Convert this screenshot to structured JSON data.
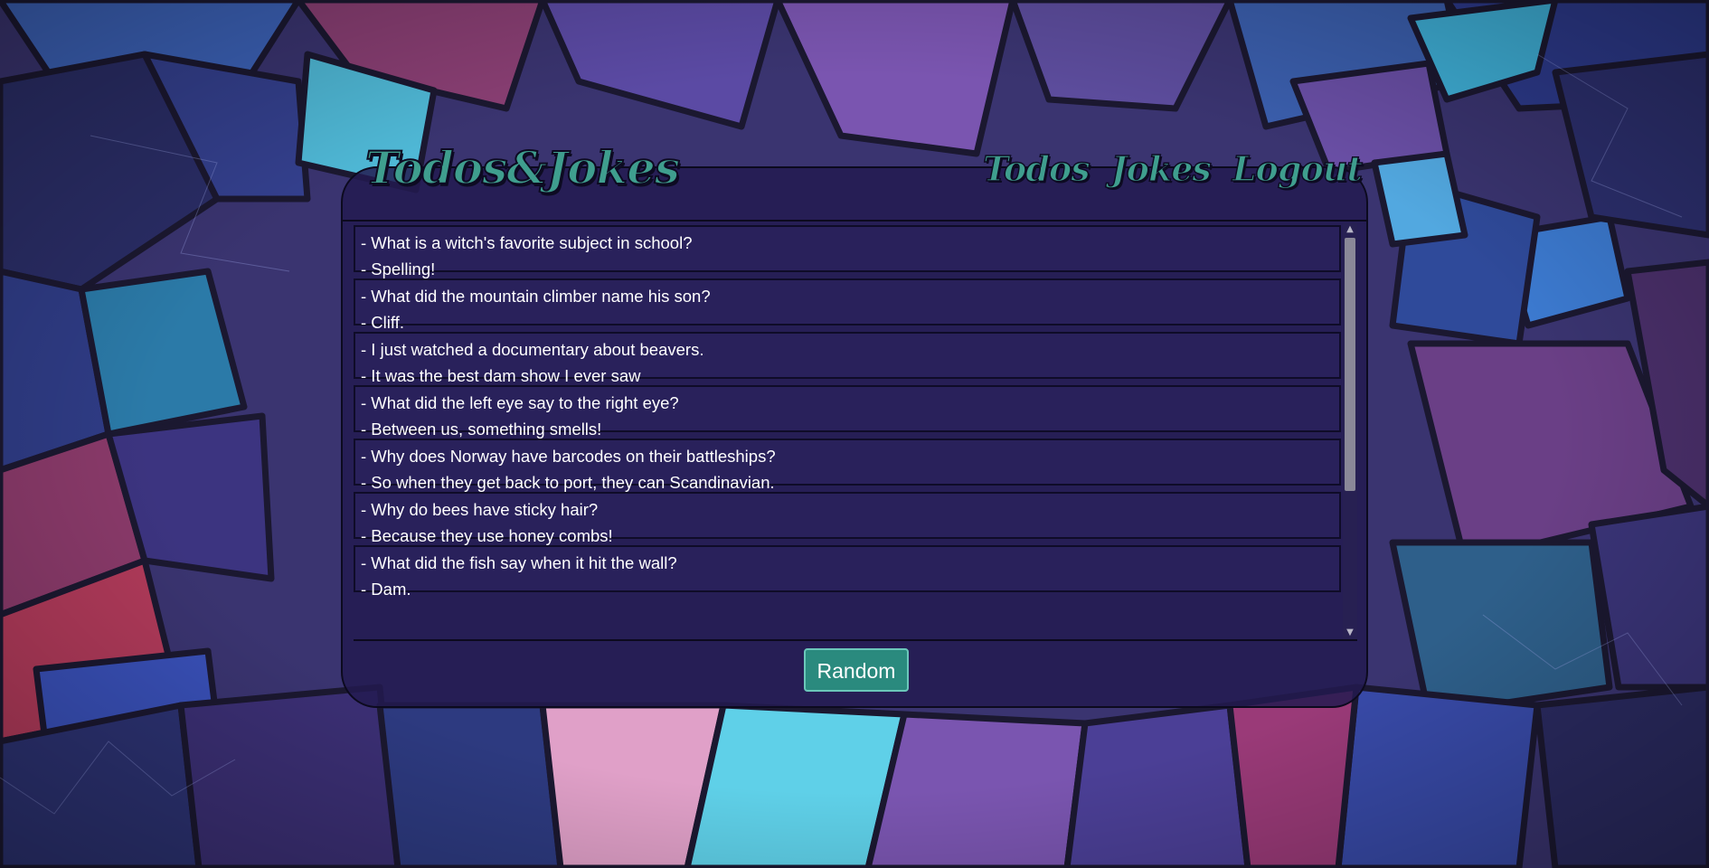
{
  "app": {
    "logo_text": "Todos&Jokes"
  },
  "nav": {
    "items": [
      {
        "label": "Todos"
      },
      {
        "label": "Jokes"
      },
      {
        "label": "Logout"
      }
    ]
  },
  "jokes": [
    {
      "setup": "- What is a witch's favorite subject in school?",
      "punchline": "- Spelling!"
    },
    {
      "setup": "- What did the mountain climber name his son?",
      "punchline": "- Cliff."
    },
    {
      "setup": "- I just watched a documentary about beavers.",
      "punchline": "- It was the best dam show I ever saw"
    },
    {
      "setup": "- What did the left eye say to the right eye?",
      "punchline": "- Between us, something smells!"
    },
    {
      "setup": "- Why does Norway have barcodes on their battleships?",
      "punchline": "- So when they get back to port, they can Scandinavian."
    },
    {
      "setup": "- Why do bees have sticky hair?",
      "punchline": "- Because they use honey combs!"
    },
    {
      "setup": "- What did the fish say when it hit the wall?",
      "punchline": "- Dam."
    }
  ],
  "random_button": {
    "label": "Random"
  },
  "scrollbar": {
    "scroll_position": 0
  },
  "icons": {
    "scroll_up": "chevron-up-icon",
    "scroll_down": "chevron-down-icon"
  },
  "colors": {
    "accent": "#3f9e8e",
    "button": "#2a8a7e",
    "card": "#221a50"
  }
}
